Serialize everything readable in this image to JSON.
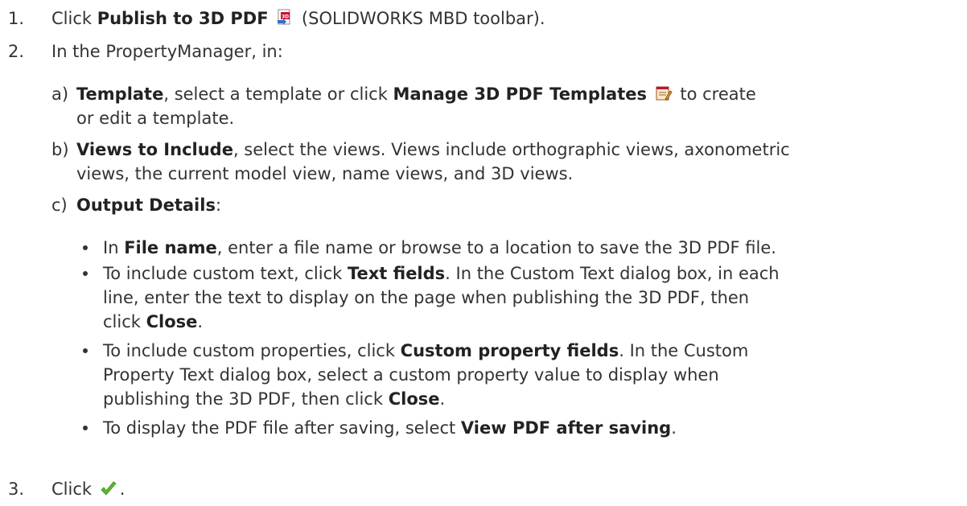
{
  "step1": {
    "number": "1.",
    "pre": "Click ",
    "bold": "Publish to 3D PDF",
    "icon": "publish-3d-pdf-icon",
    "post": " (SOLIDWORKS MBD toolbar)."
  },
  "step2": {
    "number": "2.",
    "text": "In the PropertyManager, in:",
    "a": {
      "label": "a)",
      "bold": "Template",
      "mid": ", select a template or click ",
      "bold2": "Manage 3D PDF Templates",
      "icon": "manage-templates-icon",
      "post": " to create",
      "line2": "or edit a template."
    },
    "b": {
      "label": "b)",
      "bold": "Views to Include",
      "post": ", select the views. Views include orthographic views, axonometric",
      "line2": "views, the current model view, name views, and 3D views."
    },
    "c": {
      "label": "c)",
      "bold": "Output Details",
      "post": ":",
      "bullets": {
        "b1": {
          "pre": "In ",
          "bold": "File name",
          "post": ", enter a file name or browse to a location to save the 3D PDF file."
        },
        "b2": {
          "pre": "To include custom text, click ",
          "bold": "Text fields",
          "post": ". In the Custom Text dialog box, in each",
          "line2": "line, enter the text to display on the page when publishing the 3D PDF, then",
          "line3pre": "click ",
          "line3bold": "Close",
          "line3post": "."
        },
        "b3": {
          "pre": "To include custom properties, click ",
          "bold": "Custom property fields",
          "post": ". In the Custom",
          "line2": "Property Text dialog box, select a custom property value to display when",
          "line3pre": "publishing the 3D PDF, then click ",
          "line3bold": "Close",
          "line3post": "."
        },
        "b4": {
          "pre": "To display the PDF file after saving, select ",
          "bold": "View PDF after saving",
          "post": "."
        }
      }
    }
  },
  "step3": {
    "number": "3.",
    "pre": "Click ",
    "icon": "checkmark-icon",
    "post": "."
  },
  "colors": {
    "text": "#333333",
    "check_green": "#5cb82e",
    "pdf_red": "#c8102e"
  }
}
